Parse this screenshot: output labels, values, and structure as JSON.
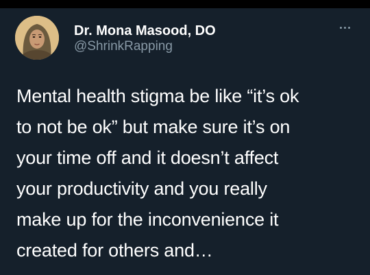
{
  "author": {
    "display_name": "Dr. Mona Masood, DO",
    "handle": "@ShrinkRapping",
    "avatar_icon": "profile-photo"
  },
  "menu": {
    "icon": "more-horizontal-icon"
  },
  "tweet": {
    "lines": [
      "Mental health stigma be like “it’s ok",
      "to not be ok” but make sure it’s on",
      "your time off and it doesn’t affect",
      "your productivity and you really",
      "make up for the inconvenience it",
      "created for others and…"
    ]
  },
  "colors": {
    "background": "#15202b",
    "text_primary": "#ffffff",
    "text_secondary": "#8899a6"
  }
}
